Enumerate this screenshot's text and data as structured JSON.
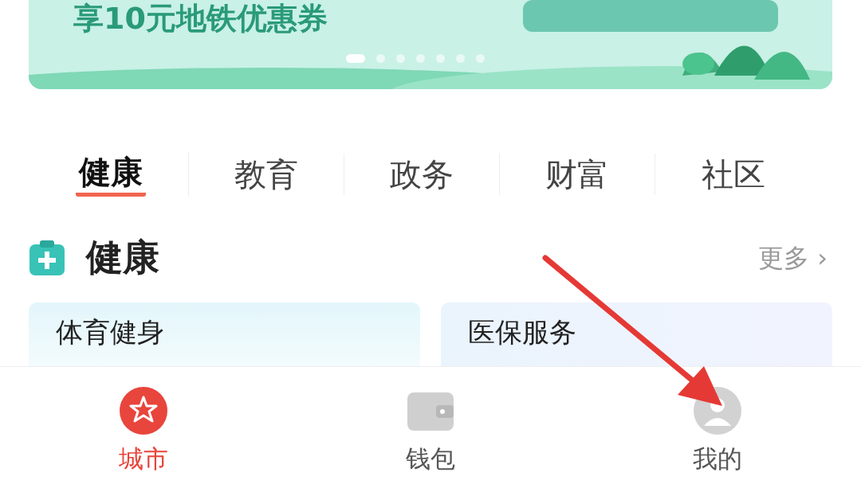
{
  "banner": {
    "headline": "享10元地铁优惠券",
    "dots": [
      {
        "selected": true
      },
      {
        "selected": false
      },
      {
        "selected": false
      },
      {
        "selected": false
      },
      {
        "selected": false
      },
      {
        "selected": false
      },
      {
        "selected": false
      }
    ]
  },
  "tabs": [
    {
      "label": "健康",
      "selected": true
    },
    {
      "label": "教育",
      "selected": false
    },
    {
      "label": "政务",
      "selected": false
    },
    {
      "label": "财富",
      "selected": false
    },
    {
      "label": "社区",
      "selected": false
    }
  ],
  "section": {
    "title": "健康",
    "more": "更多",
    "more_arrow": "›"
  },
  "cards": [
    {
      "title": "体育健身"
    },
    {
      "title": "医保服务"
    }
  ],
  "nav": [
    {
      "label": "城市",
      "kind": "city",
      "selected": true
    },
    {
      "label": "钱包",
      "kind": "wallet",
      "selected": false
    },
    {
      "label": "我的",
      "kind": "me",
      "selected": false
    }
  ]
}
